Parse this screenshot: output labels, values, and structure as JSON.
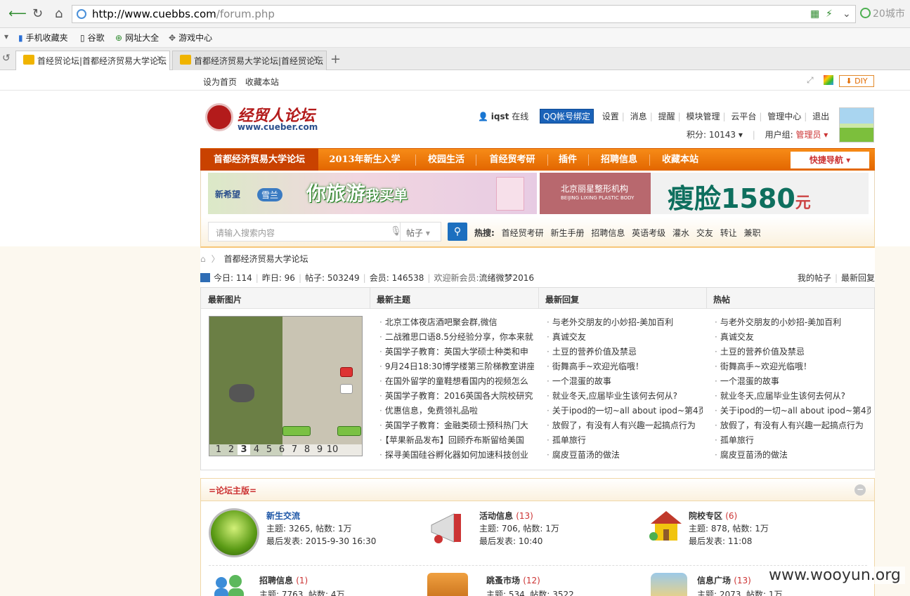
{
  "browser": {
    "url_host": "http://www.cuebbs.com",
    "url_path": "/forum.php",
    "search_text": "20城市",
    "favorites": [
      "手机收藏夹",
      "谷歌",
      "网址大全",
      "游戏中心"
    ],
    "tabs": [
      {
        "title": "首经贸论坛|首都经济贸易大学论坛"
      },
      {
        "title": "首都经济贸易大学论坛|首经贸论坛"
      }
    ]
  },
  "toplinks": [
    "设为首页",
    "收藏本站"
  ],
  "diy_label": "DIY",
  "logo": {
    "title": "经贸人论坛",
    "subtitle": "www.cueber.com"
  },
  "user": {
    "name": "iqst",
    "status": "在线",
    "qq_bind": "QQ帐号绑定",
    "links": [
      "设置",
      "消息",
      "提醒",
      "模块管理",
      "云平台",
      "管理中心",
      "退出"
    ],
    "points_label": "积分: 10143",
    "group_label": "用户组:",
    "group_value": "管理员"
  },
  "nav": {
    "items": [
      "首都经济贸易大学论坛",
      "2013年新生入学",
      "校园生活",
      "首经贸考研",
      "插件",
      "招聘信息",
      "收藏本站"
    ],
    "quick": "快捷导航"
  },
  "banner": {
    "ad1_brand": "新希望",
    "ad1_brand2": "雪兰",
    "ad1_slogan_a": "你旅游",
    "ad1_slogan_b": "我买单",
    "ad2_name": "北京丽星整形机构",
    "ad2_name_en": "BEIJING LIXING PLASTIC BODY",
    "ad2_big": "瘦脸1580",
    "ad2_unit": "元"
  },
  "search": {
    "placeholder": "请输入搜索内容",
    "type": "帖子",
    "hot_label": "热搜:",
    "hot": [
      "首经贸考研",
      "新生手册",
      "招聘信息",
      "英语考级",
      "灌水",
      "交友",
      "转让",
      "兼职"
    ]
  },
  "breadcrumb": "首都经济贸易大学论坛",
  "stats": {
    "today": "今日: 114",
    "yesterday": "昨日: 96",
    "posts": "帖子: 503249",
    "members": "会员: 146538",
    "welcome_label": "欢迎新会员:",
    "welcome_user": "流绪微梦2016",
    "my_posts": "我的帖子",
    "latest_replies": "最新回复"
  },
  "grid": {
    "headers": [
      "最新图片",
      "最新主题",
      "最新回复",
      "热帖"
    ],
    "pager": [
      "1",
      "2",
      "3",
      "4",
      "5",
      "6",
      "7",
      "8",
      "9",
      "10"
    ],
    "latest_topics": [
      "北京工体夜店酒吧聚会群,微信",
      "二战雅思口语8.5分经验分享，你本来就",
      "英国学子教育：英国大学硕士种类和申",
      "9月24日18:30博学楼第三阶梯教室讲座",
      "在国外留学的童鞋想看国内的视频怎么",
      "英国学子教育：2016英国各大院校研究",
      "优惠信息，免费领礼品啦",
      "英国学子教育：金融类硕士预科热门大",
      "【苹果新品发布】回顾乔布斯留给美国",
      "探寻美国硅谷孵化器如何加速科技创业"
    ],
    "latest_replies": [
      "与老外交朋友的小妙招-美加百利",
      "真诚交友",
      "土豆的营养价值及禁忌",
      "街舞高手~欢迎光临哦！",
      "一个混蛋的故事",
      "就业冬天,应届毕业生该何去何从?",
      "关于ipod的一切~all about ipod~第4页",
      "放假了，有没有人有兴趣一起搞点行为",
      "孤单旅行",
      "腐皮豆苗汤的做法"
    ],
    "hot_posts": [
      "与老外交朋友的小妙招-美加百利",
      "真诚交友",
      "土豆的营养价值及禁忌",
      "街舞高手~欢迎光临哦！",
      "一个混蛋的故事",
      "就业冬天,应届毕业生该何去何从?",
      "关于ipod的一切~all about ipod~第4页",
      "放假了，有没有人有兴趣一起搞点行为",
      "孤单旅行",
      "腐皮豆苗汤的做法"
    ]
  },
  "forums": {
    "title": "=论坛主版=",
    "collapse": "−",
    "row1": [
      {
        "name": "新生交流",
        "count": "",
        "stats": "主题: 3265, 帖数: 1万",
        "last": "最后发表: 2015-9-30 16:30"
      },
      {
        "name": "活动信息",
        "count": "(13)",
        "stats": "主题: 706, 帖数: 1万",
        "last": "最后发表: 10:40"
      },
      {
        "name": "院校专区",
        "count": "(6)",
        "stats": "主题: 878, 帖数: 1万",
        "last": "最后发表: 11:08"
      }
    ],
    "row2": [
      {
        "name": "招聘信息",
        "count": "(1)",
        "stats": "主题: 7763, 帖数: 4万"
      },
      {
        "name": "跳蚤市场",
        "count": "(12)",
        "stats": "主题: 534, 帖数: 3522"
      },
      {
        "name": "信息广场",
        "count": "(13)",
        "stats": "主题: 2073, 帖数: 1万"
      }
    ]
  },
  "watermark": "www.wooyun.org"
}
